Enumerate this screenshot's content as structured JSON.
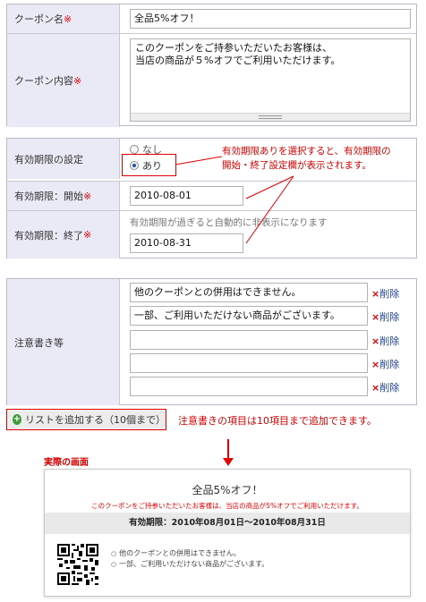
{
  "form": {
    "required_mark": "※",
    "coupon_name": {
      "label": "クーポン名",
      "value": "全品5%オフ！"
    },
    "coupon_content": {
      "label": "クーポン内容",
      "line1": "このクーポンをご持参いただいたお客様は、",
      "line2": "当店の商品が５%オフでご利用いただけます。"
    },
    "expiry_setting": {
      "label": "有効期限の設定",
      "option_none": "なし",
      "option_on": "あり",
      "selected": "あり"
    },
    "expiry_start": {
      "label": "有効期限：開始",
      "value": "2010-08-01"
    },
    "expiry_end": {
      "label": "有効期限：終了",
      "hint": "有効期限が過ぎると自動的に非表示になります",
      "value": "2010-08-31"
    },
    "notes": {
      "label": "注意書き等",
      "delete_label": "削除",
      "delete_mark": "×",
      "items": [
        "他のクーポンとの併用はできません。",
        "一部、ご利用いただけない商品がございます。",
        "",
        "",
        ""
      ]
    },
    "add_button": "リストを追加する（10個まで）"
  },
  "annotations": {
    "expiry_note_line1": "有効期限ありを選択すると、有効期限の",
    "expiry_note_line2": "開始・終了設定欄が表示されます。",
    "add_note": "注意書きの項目は10項目まで追加できます。",
    "actual_screen": "実際の画面"
  },
  "preview": {
    "title": "全品5%オフ！",
    "description": "このクーポンをご持参いただいたお客様は、当店の商品が5%オフでご利用いただけます。",
    "expiry": "有効期限：2010年08月01日～2010年08月31日",
    "terms": [
      "他のクーポンとの併用はできません。",
      "一部、ご利用いただけない商品がございます。"
    ]
  },
  "colors": {
    "accent_red": "#e40000",
    "label_bg": "#eaeaf7",
    "link_blue": "#1c3f94"
  },
  "icons": [
    "plus-circle-icon",
    "delete-x-icon",
    "qr-code-icon",
    "resize-grip-icon",
    "arrow-down-icon"
  ]
}
